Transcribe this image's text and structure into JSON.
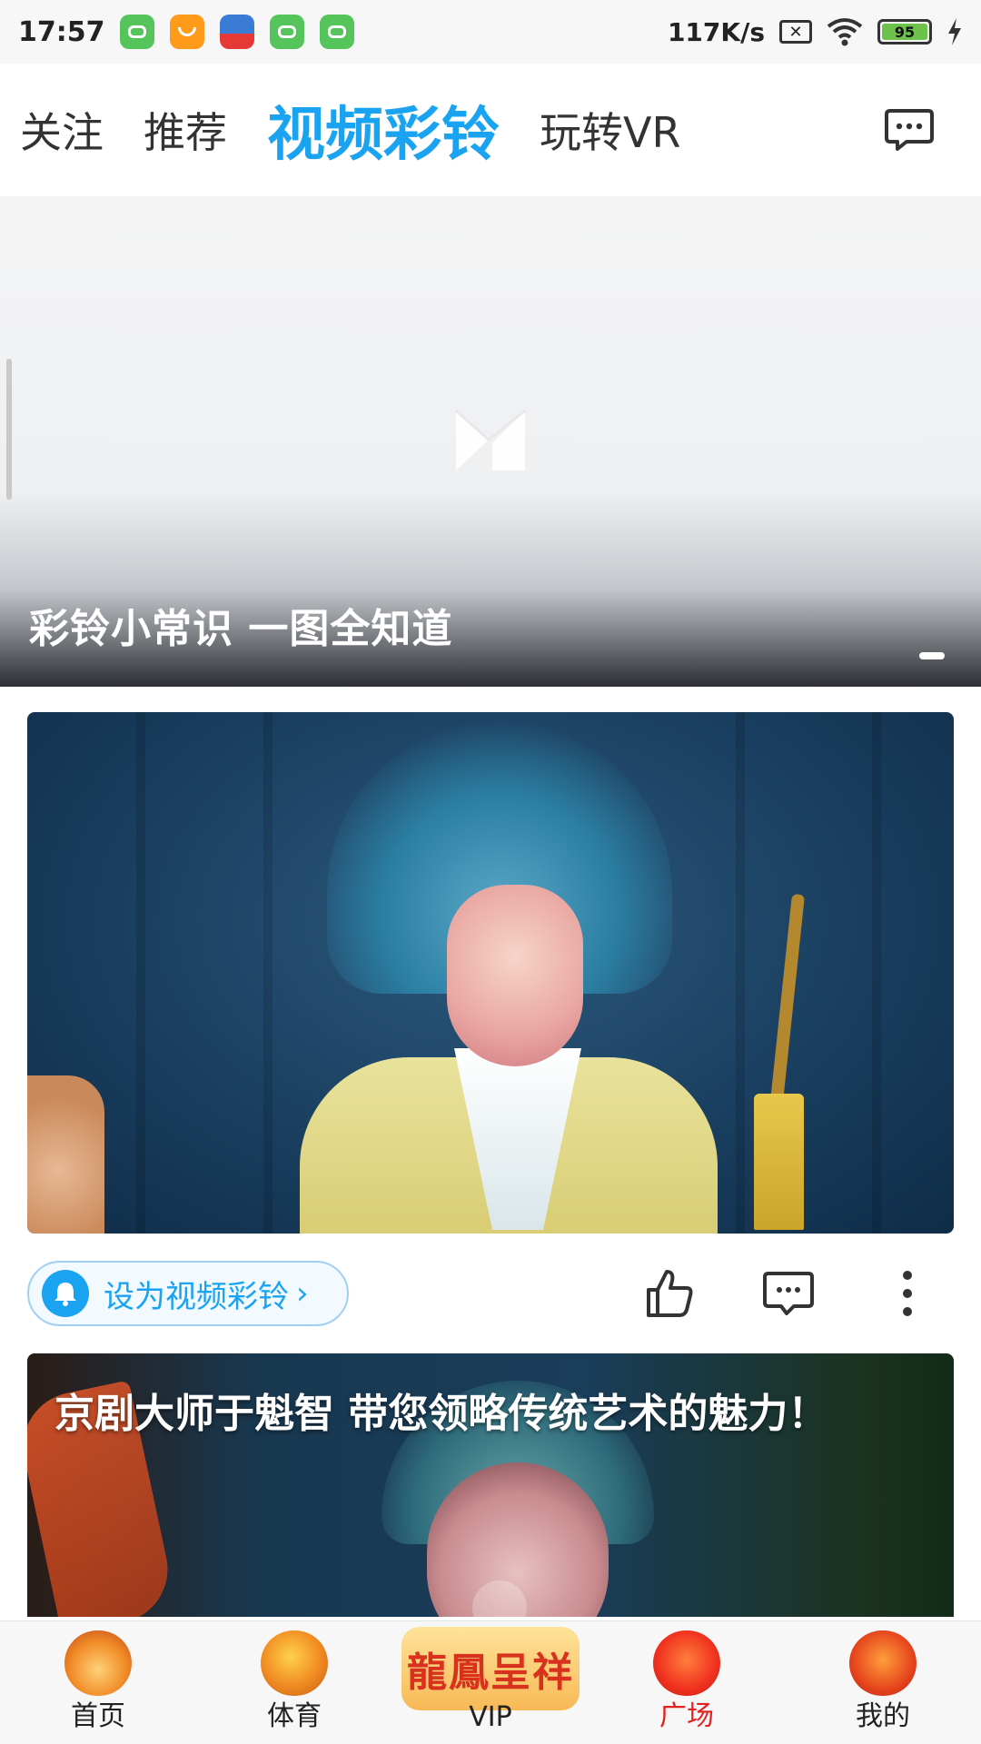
{
  "status_bar": {
    "time": "17:57",
    "network_speed": "117K/s",
    "battery": "95",
    "notification_icons": [
      "app-green-icon",
      "app-orange-icon",
      "app-multicolor-icon",
      "app-green-icon",
      "app-green-icon"
    ]
  },
  "top_tabs": {
    "items": [
      {
        "label": "关注",
        "active": false
      },
      {
        "label": "推荐",
        "active": false
      },
      {
        "label": "视频彩铃",
        "active": true
      },
      {
        "label": "玩转VR",
        "active": false
      }
    ],
    "accent_color": "#1aa3f0"
  },
  "banner": {
    "title": "彩铃小常识 一图全知道"
  },
  "video_card_1": {
    "set_ringtone_label": "设为视频彩铃"
  },
  "video_card_2": {
    "title": "京剧大师于魁智 带您领略传统艺术的魅力！"
  },
  "bottom_nav": {
    "items": [
      {
        "label": "首页",
        "active": false
      },
      {
        "label": "体育",
        "active": false
      },
      {
        "label": "VIP",
        "active": false,
        "art_text": "龍鳳呈祥"
      },
      {
        "label": "广场",
        "active": true
      },
      {
        "label": "我的",
        "active": false
      }
    ],
    "active_color": "#e0231e"
  }
}
